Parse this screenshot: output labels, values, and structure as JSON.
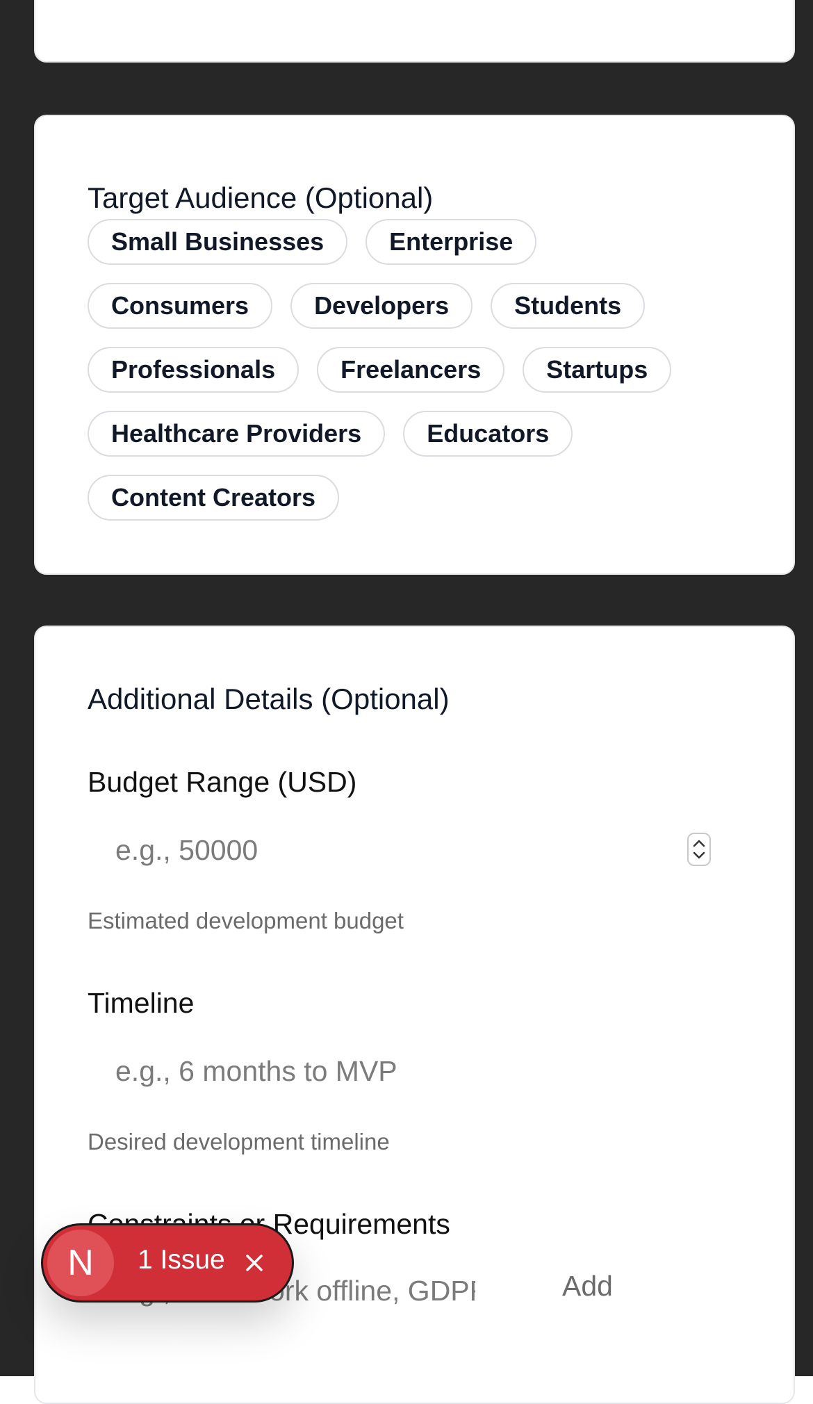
{
  "target_audience": {
    "title": "Target Audience (Optional)",
    "rows": [
      [
        "Small Businesses",
        "Enterprise"
      ],
      [
        "Consumers",
        "Developers",
        "Students"
      ],
      [
        "Professionals",
        "Freelancers",
        "Startups"
      ],
      [
        "Healthcare Providers",
        "Educators"
      ],
      [
        "Content Creators"
      ]
    ]
  },
  "additional_details": {
    "title": "Additional Details (Optional)",
    "budget": {
      "label": "Budget Range (USD)",
      "placeholder": "e.g., 50000",
      "help": "Estimated development budget"
    },
    "timeline": {
      "label": "Timeline",
      "placeholder": "e.g., 6 months to MVP",
      "help": "Desired development timeline"
    },
    "constraints": {
      "label": "Constraints or Requirements",
      "placeholder": "e.g., must work offline, GDPR",
      "add_label": "Add"
    }
  },
  "issue_badge": {
    "avatar_letter": "N",
    "text": "1 Issue",
    "icon": "close-icon"
  },
  "colors": {
    "background": "#272727",
    "card": "#ffffff",
    "badge": "#d02f37"
  }
}
